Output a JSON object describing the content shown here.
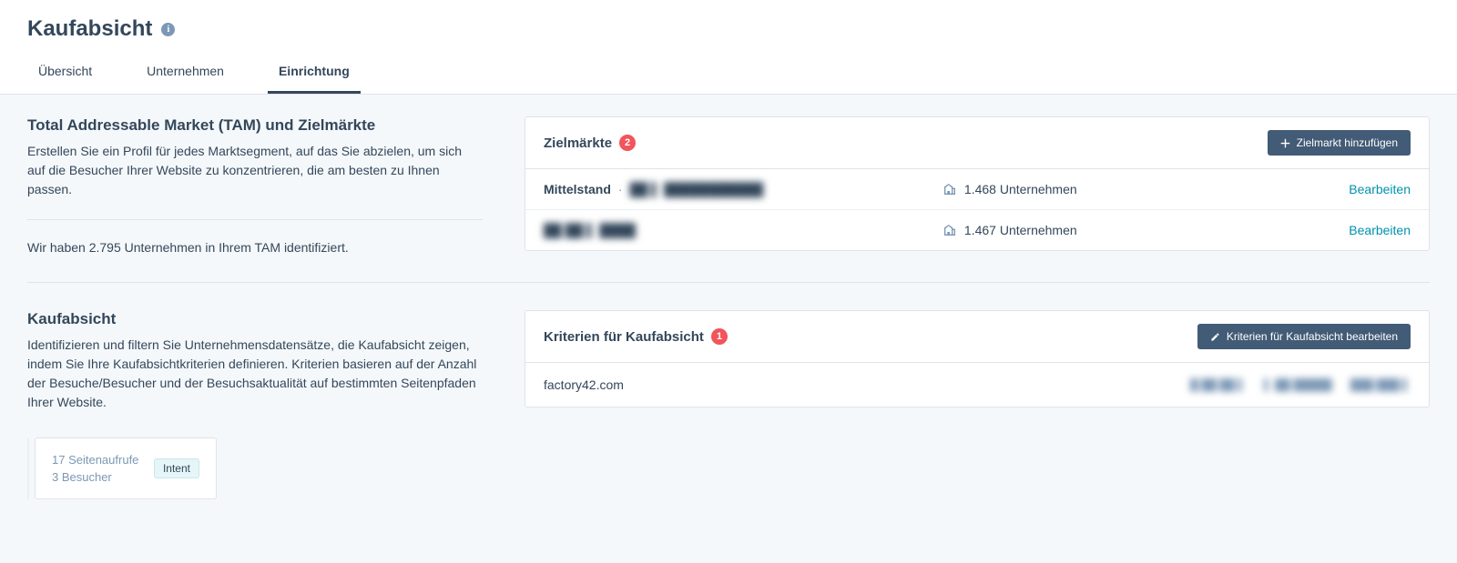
{
  "header": {
    "title": "Kaufabsicht",
    "tabs": [
      {
        "label": "Übersicht"
      },
      {
        "label": "Unternehmen"
      },
      {
        "label": "Einrichtung",
        "active": true
      }
    ]
  },
  "tam_section": {
    "heading": "Total Addressable Market (TAM) und Zielmärkte",
    "description": "Erstellen Sie ein Profil für jedes Marktsegment, auf das Sie abzielen, um sich auf die Besucher Ihrer Website zu konzentrieren, die am besten zu Ihnen passen.",
    "summary": "Wir haben 2.795 Unternehmen in Ihrem TAM identifiziert.",
    "card_title": "Zielmärkte",
    "count_badge": "2",
    "add_button": "Zielmarkt hinzufügen",
    "rows": [
      {
        "name": "Mittelstand",
        "separator": "·",
        "sub_blurred": "██ ▌ ███████████",
        "count": "1.468 Unternehmen",
        "action": "Bearbeiten"
      },
      {
        "name_blurred": "██ ██ ▌ ████",
        "count": "1.467 Unternehmen",
        "action": "Bearbeiten"
      }
    ]
  },
  "intent_section": {
    "heading": "Kaufabsicht",
    "description": "Identifizieren und filtern Sie Unternehmensdatensätze, die Kaufabsicht zeigen, indem Sie Ihre Kaufabsichtkriterien definieren. Kriterien basieren auf der Anzahl der Besuche/Besucher und der Besuchsaktualität auf bestimmten Seitenpfaden Ihrer Website.",
    "preview": {
      "pageviews": "17 Seitenaufrufe",
      "visitors": "3 Besucher",
      "tag": "Intent"
    },
    "card_title": "Kriterien für Kaufabsicht",
    "count_badge": "1",
    "edit_button": "Kriterien für Kaufabsicht bearbeiten",
    "criteria": {
      "domain": "factory42.com",
      "meta1": "█ ██ ██ ▌",
      "meta2": "▌ ██ █████",
      "meta3": "███ ███ ▌"
    }
  }
}
